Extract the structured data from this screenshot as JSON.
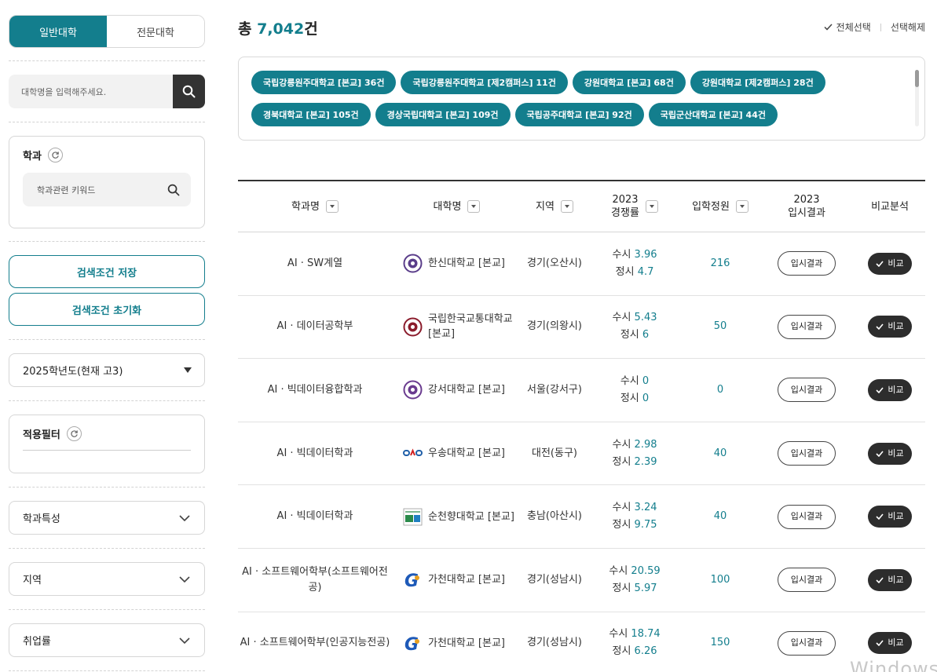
{
  "sidebar": {
    "tabs": [
      {
        "label": "일반대학",
        "active": true
      },
      {
        "label": "전문대학",
        "active": false
      }
    ],
    "search_placeholder": "대학명을 입력해주세요.",
    "major_panel": {
      "title": "학과",
      "keyword_placeholder": "학과관련 키워드"
    },
    "save_button": "검색조건 저장",
    "reset_button": "검색조건 초기화",
    "year_select": "2025학년도(현재 고3)",
    "filter_panel": {
      "title": "적용필터"
    },
    "accordions": [
      "학과특성",
      "지역",
      "취업률"
    ]
  },
  "header": {
    "total_prefix": "총 ",
    "total_count": "7,042",
    "total_suffix": "건",
    "select_all": "전체선택",
    "deselect": "선택해제"
  },
  "chips": [
    "국립강릉원주대학교 [본교] 36건",
    "국립강릉원주대학교 [제2캠퍼스] 11건",
    "강원대학교 [본교] 68건",
    "강원대학교 [제2캠퍼스] 28건",
    "경북대학교 [본교] 105건",
    "경상국립대학교 [본교] 109건",
    "국립공주대학교 [본교] 92건",
    "국립군산대학교 [본교] 44건"
  ],
  "table": {
    "headers": {
      "major": "학과명",
      "univ": "대학명",
      "region": "지역",
      "comp_year": "2023",
      "comp_label": "경쟁률",
      "quota": "입학정원",
      "result_year": "2023",
      "result_label": "입시결과",
      "compare": "비교분석"
    },
    "result_button": "입시결과",
    "compare_button": "비교",
    "susi_label": "수시",
    "jeongsi_label": "정시",
    "rows": [
      {
        "major": "AI · SW계열",
        "univ": "한신대학교 [본교]",
        "region": "경기(오산시)",
        "susi": "3.96",
        "jeongsi": "4.7",
        "quota": "216",
        "logo_color": "#5a3d8a"
      },
      {
        "major": "AI · 데이터공학부",
        "univ": "국립한국교통대학교 [본교]",
        "region": "경기(의왕시)",
        "susi": "5.43",
        "jeongsi": "6",
        "quota": "50",
        "logo_color": "#8b1c2c"
      },
      {
        "major": "AI · 빅데이터융합학과",
        "univ": "강서대학교 [본교]",
        "region": "서울(강서구)",
        "susi": "0",
        "jeongsi": "0",
        "quota": "0",
        "logo_color": "#6a3b8f"
      },
      {
        "major": "AI · 빅데이터학과",
        "univ": "우송대학교 [본교]",
        "region": "대전(동구)",
        "susi": "2.98",
        "jeongsi": "2.39",
        "quota": "40",
        "logo_color": "#1f5fa8"
      },
      {
        "major": "AI · 빅데이터학과",
        "univ": "순천향대학교 [본교]",
        "region": "충남(아산시)",
        "susi": "3.24",
        "jeongsi": "9.75",
        "quota": "40",
        "logo_color": "#2a8a4a"
      },
      {
        "major": "AI · 소프트웨어학부(소프트웨어전공)",
        "univ": "가천대학교 [본교]",
        "region": "경기(성남시)",
        "susi": "20.59",
        "jeongsi": "5.97",
        "quota": "100",
        "logo_color": "#1e5ab8"
      },
      {
        "major": "AI · 소프트웨어학부(인공지능전공)",
        "univ": "가천대학교 [본교]",
        "region": "경기(성남시)",
        "susi": "18.74",
        "jeongsi": "6.26",
        "quota": "150",
        "logo_color": "#1e5ab8"
      }
    ]
  },
  "watermark": "Windows",
  "colors": {
    "accent": "#137e8d",
    "dark": "#2d2d2d"
  }
}
